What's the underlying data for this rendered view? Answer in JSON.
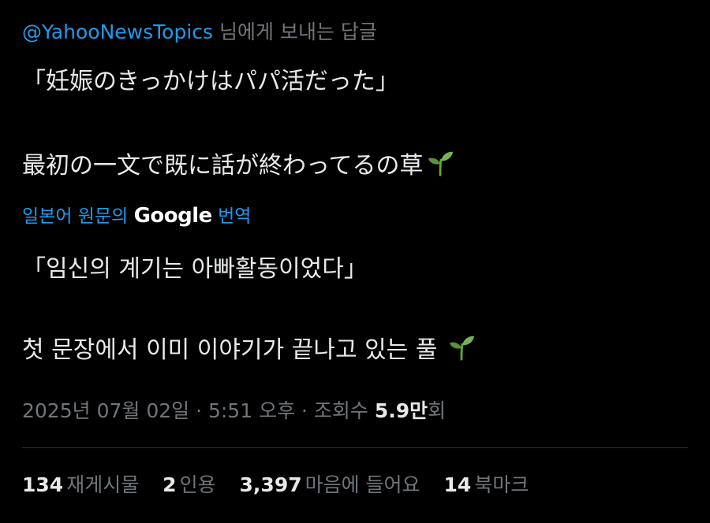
{
  "reply": {
    "mention": "@YahooNewsTopics",
    "suffix": " 님에게 보내는 답글"
  },
  "tweet": {
    "line1": "「妊娠のきっかけはパパ活だった」",
    "line2": "最初の一文で既に話が終わってるの草"
  },
  "translation": {
    "prefix": "일본어 원문의 ",
    "google": "Google",
    "suffix": " 번역",
    "line1": "「임신의 계기는 아빠활동이었다」",
    "line2": "첫 문장에서 이미 이야기가 끝나고 있는 풀 "
  },
  "meta": {
    "timestamp": "2025년 07월 02일 · 5:51 오후 · 조회수 ",
    "views": "5.9만",
    "views_suffix": "회"
  },
  "stats": [
    {
      "count": "134",
      "label": "재게시물"
    },
    {
      "count": "2",
      "label": "인용"
    },
    {
      "count": "3,397",
      "label": "마음에 들어요"
    },
    {
      "count": "14",
      "label": "북마크"
    }
  ],
  "colors": {
    "background": "#000000",
    "text": "#e7e9ea",
    "muted": "#71767b",
    "link": "#1d9bf0"
  },
  "icons": {
    "sprout": "seedling-emoji"
  }
}
